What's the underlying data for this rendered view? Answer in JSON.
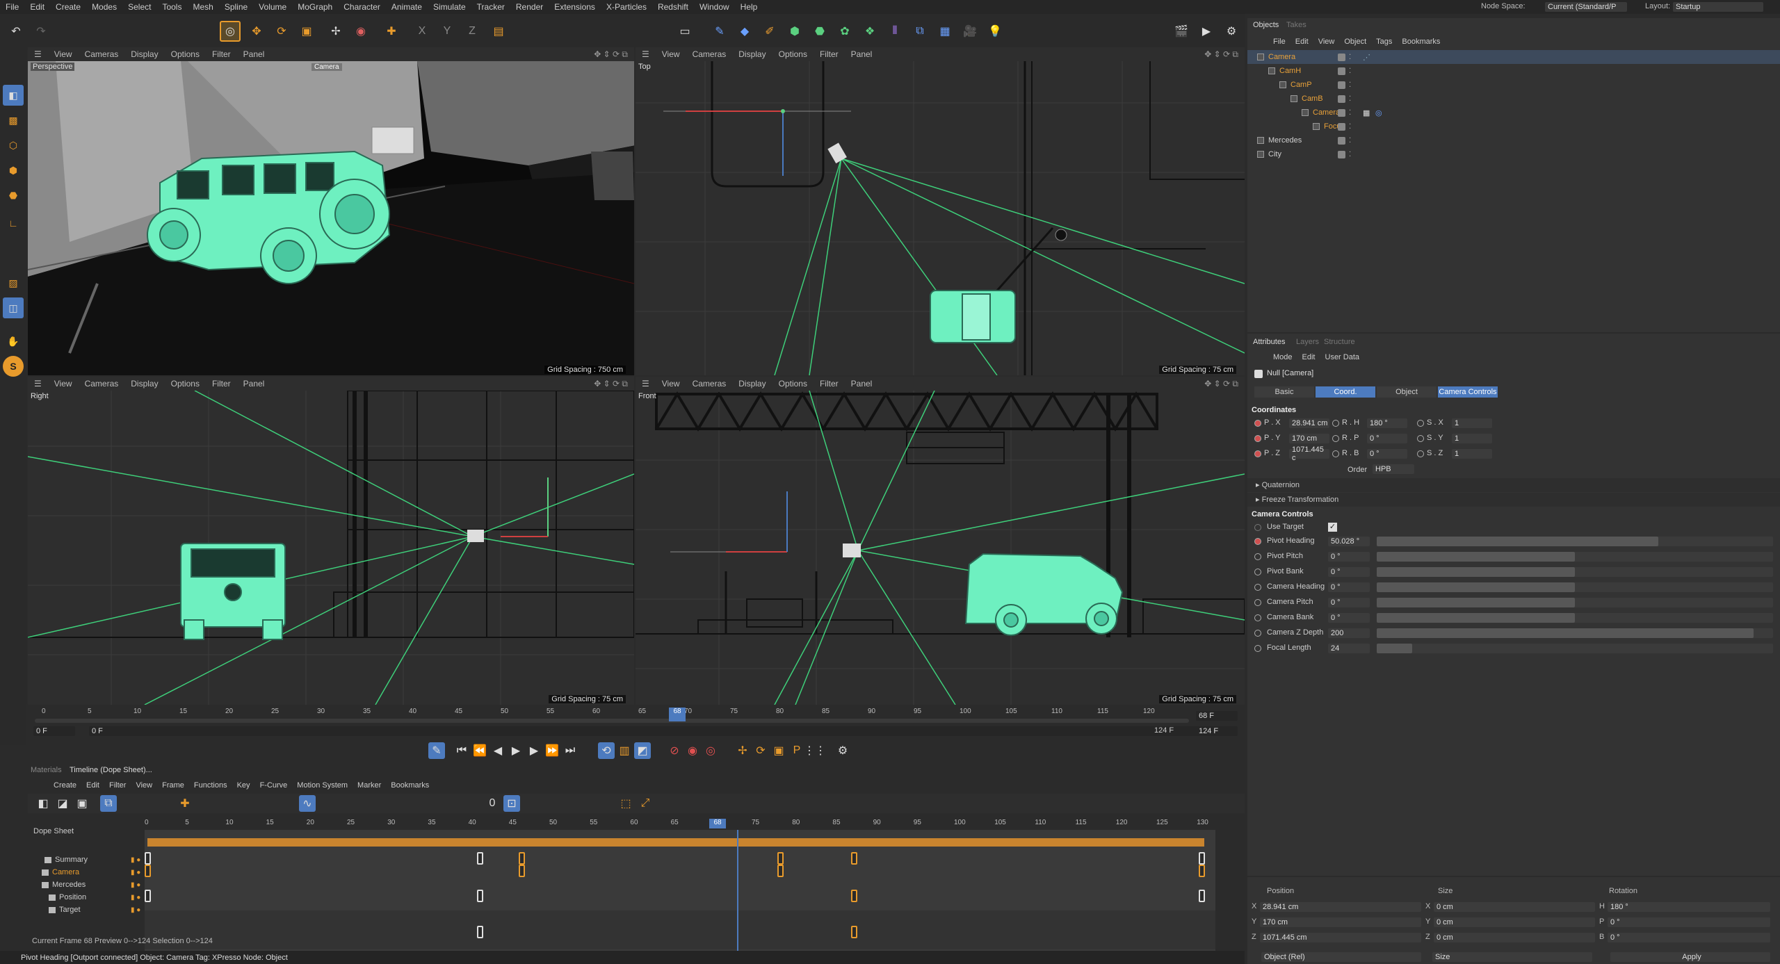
{
  "menu": [
    "File",
    "Edit",
    "Create",
    "Modes",
    "Select",
    "Tools",
    "Mesh",
    "Spline",
    "Volume",
    "MoGraph",
    "Character",
    "Animate",
    "Simulate",
    "Tracker",
    "Render",
    "Extensions",
    "X-Particles",
    "Redshift",
    "Window",
    "Help"
  ],
  "node_space": {
    "label": "Node Space:",
    "value": "Current (Standard/P"
  },
  "layout": {
    "label": "Layout:",
    "value": "Startup"
  },
  "viewport_menu": [
    "View",
    "Cameras",
    "Display",
    "Options",
    "Filter",
    "Panel"
  ],
  "viewports": {
    "perspective": {
      "label": "Perspective",
      "camera_tag": "Camera",
      "grid": "Grid Spacing : 750 cm"
    },
    "top": {
      "label": "Top",
      "grid": "Grid Spacing : 75 cm"
    },
    "right": {
      "label": "Right",
      "grid": "Grid Spacing : 75 cm"
    },
    "front": {
      "label": "Front",
      "grid": "Grid Spacing : 75 cm"
    }
  },
  "objects_panel": {
    "tabs": [
      "Objects",
      "Takes"
    ],
    "menu": [
      "File",
      "Edit",
      "View",
      "Object",
      "Tags",
      "Bookmarks"
    ],
    "items": [
      {
        "name": "Camera",
        "level": 0,
        "color": "#e8a13a"
      },
      {
        "name": "CamH",
        "level": 1,
        "color": "#e8a13a"
      },
      {
        "name": "CamP",
        "level": 2,
        "color": "#e8a13a"
      },
      {
        "name": "CamB",
        "level": 3,
        "color": "#e8a13a"
      },
      {
        "name": "Camera",
        "level": 4,
        "color": "#e8a13a"
      },
      {
        "name": "Focus",
        "level": 5,
        "color": "#e8a13a"
      },
      {
        "name": "Mercedes",
        "level": 0,
        "color": "#cfcfcf"
      },
      {
        "name": "City",
        "level": 0,
        "color": "#cfcfcf"
      }
    ]
  },
  "attributes": {
    "tabs": [
      "Attributes",
      "Layers",
      "Structure"
    ],
    "menu": [
      "Mode",
      "Edit",
      "User Data"
    ],
    "object_label": "Null [Camera]",
    "subtabs": [
      "Basic",
      "Coord.",
      "Object",
      "Camera Controls"
    ],
    "coord_title": "Coordinates",
    "coords": [
      {
        "p_label": "P . X",
        "p_val": "28.941 cm",
        "r_label": "R . H",
        "r_val": "180 °",
        "s_label": "S . X",
        "s_val": "1"
      },
      {
        "p_label": "P . Y",
        "p_val": "170 cm",
        "r_label": "R . P",
        "r_val": "0 °",
        "s_label": "S . Y",
        "s_val": "1"
      },
      {
        "p_label": "P . Z",
        "p_val": "1071.445 c",
        "r_label": "R . B",
        "r_val": "0 °",
        "s_label": "S . Z",
        "s_val": "1"
      }
    ],
    "order_label": "Order",
    "order_value": "HPB",
    "quaternion": "Quaternion",
    "freeze": "Freeze Transformation",
    "camera_controls_title": "Camera Controls",
    "use_target": "Use Target",
    "controls": [
      {
        "label": "Pivot Heading",
        "value": "50.028 °",
        "fill": 0.71
      },
      {
        "label": "Pivot Pitch",
        "value": "0 °",
        "fill": 0.5
      },
      {
        "label": "Pivot Bank",
        "value": "0 °",
        "fill": 0.5
      },
      {
        "label": "Camera Heading",
        "value": "0 °",
        "fill": 0.5
      },
      {
        "label": "Camera Pitch",
        "value": "0 °",
        "fill": 0.5
      },
      {
        "label": "Camera Bank",
        "value": "0 °",
        "fill": 0.5
      },
      {
        "label": "Camera Z Depth",
        "value": "200",
        "fill": 0.95
      },
      {
        "label": "Focal Length",
        "value": "24",
        "fill": 0.09
      }
    ]
  },
  "coord_manager": {
    "headers": [
      "Position",
      "Size",
      "Rotation"
    ],
    "rows": [
      {
        "axis": "X",
        "pos": "28.941 cm",
        "size_axis": "X",
        "size": "0 cm",
        "rot_axis": "H",
        "rot": "180 °"
      },
      {
        "axis": "Y",
        "pos": "170 cm",
        "size_axis": "Y",
        "size": "0 cm",
        "rot_axis": "P",
        "rot": "0 °"
      },
      {
        "axis": "Z",
        "pos": "1071.445 cm",
        "size_axis": "Z",
        "size": "0 cm",
        "rot_axis": "B",
        "rot": "0 °"
      }
    ],
    "mode1": "Object (Rel)",
    "mode2": "Size",
    "apply": "Apply"
  },
  "timeline_ruler": [
    "0",
    "5",
    "10",
    "15",
    "20",
    "25",
    "30",
    "35",
    "40",
    "45",
    "50",
    "55",
    "60",
    "65",
    "70",
    "75",
    "80",
    "85",
    "90",
    "95",
    "100",
    "105",
    "110",
    "115",
    "120"
  ],
  "current_frame_marker": "68",
  "frame_start": "0 F",
  "frame_start2": "0 F",
  "frame_current": "68 F",
  "frame_end": "124 F",
  "frame_end2": "124 F",
  "dope": {
    "tabs": [
      "Materials",
      "Timeline (Dope Sheet)..."
    ],
    "menu": [
      "Create",
      "Edit",
      "Filter",
      "View",
      "Frame",
      "Functions",
      "Key",
      "F-Curve",
      "Motion System",
      "Marker",
      "Bookmarks"
    ],
    "label": "Dope Sheet",
    "ruler": [
      "0",
      "5",
      "10",
      "15",
      "20",
      "25",
      "30",
      "35",
      "40",
      "45",
      "50",
      "55",
      "60",
      "65",
      "70",
      "75",
      "80",
      "85",
      "90",
      "95",
      "100",
      "105",
      "110",
      "115",
      "120",
      "125",
      "130"
    ],
    "marker": "68",
    "tracks": [
      "Summary",
      "Camera",
      "Mercedes",
      "Position",
      "Target"
    ],
    "footer": "Current Frame  68  Preview  0-->124    Selection  0-->124"
  },
  "status": "Pivot Heading [Outport connected] Object: Camera  Tag: XPresso  Node: Object",
  "colors": {
    "accent": "#4d7bbf",
    "mint": "#6ef0c0",
    "orange": "#e89b2c",
    "green_line": "#3ecf7a"
  }
}
